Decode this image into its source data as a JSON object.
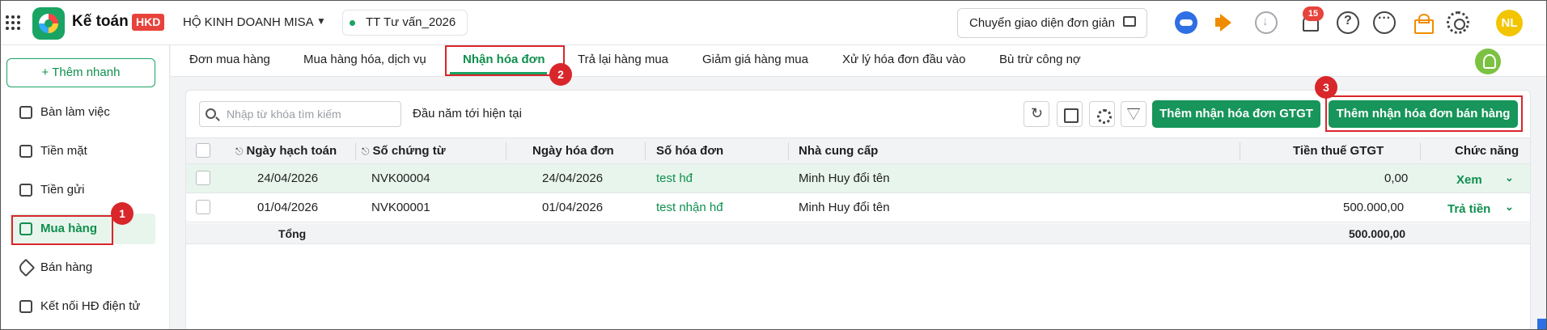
{
  "header": {
    "app_name": "Kế toán",
    "badge": "HKD",
    "company": "HỘ KINH DOANH MISA",
    "branch": "TT Tư vấn_2026",
    "switch_ui": "Chuyển giao diện đơn giản",
    "notifications": "15",
    "avatar": "NL",
    "icons": [
      "grid-icon",
      "misa-logo",
      "chevron-down-icon",
      "ai-assistant-icon",
      "megaphone-icon",
      "download-icon",
      "bell-icon",
      "help-icon",
      "more-icon",
      "gift-icon",
      "gear-icon"
    ]
  },
  "sidebar": {
    "quick_add": "+ Thêm nhanh",
    "items": [
      {
        "label": "Bàn làm việc",
        "icon": "dashboard-icon"
      },
      {
        "label": "Tiền mặt",
        "icon": "wallet-icon"
      },
      {
        "label": "Tiền gửi",
        "icon": "bank-icon"
      },
      {
        "label": "Mua hàng",
        "icon": "cart-icon",
        "active": true
      },
      {
        "label": "Bán hàng",
        "icon": "tag-icon"
      },
      {
        "label": "Kết nối HĐ điện tử",
        "icon": "e-invoice-icon"
      }
    ]
  },
  "tabs": [
    {
      "label": "Đơn mua hàng"
    },
    {
      "label": "Mua hàng hóa, dịch vụ"
    },
    {
      "label": "Nhận hóa đơn",
      "active": true
    },
    {
      "label": "Trả lại hàng mua"
    },
    {
      "label": "Giảm giá hàng mua"
    },
    {
      "label": "Xử lý hóa đơn đầu vào"
    },
    {
      "label": "Bù trừ công nợ"
    }
  ],
  "toolbar": {
    "search_placeholder": "Nhập từ khóa tìm kiếm",
    "period": "Đầu năm tới hiện tại",
    "add_vat": "Thêm nhận hóa đơn GTGT",
    "add_sales": "Thêm nhận hóa đơn bán hàng"
  },
  "table": {
    "columns": [
      "Ngày hạch toán",
      "Số chứng từ",
      "Ngày hóa đơn",
      "Số hóa đơn",
      "Nhà cung cấp",
      "Tiền thuế GTGT",
      "Chức năng"
    ],
    "rows": [
      {
        "posting_date": "24/04/2026",
        "voucher_no": "NVK00004",
        "invoice_date": "24/04/2026",
        "invoice_no": "test hđ",
        "supplier": "Minh Huy đổi tên",
        "vat": "0,00",
        "action": "Xem"
      },
      {
        "posting_date": "01/04/2026",
        "voucher_no": "NVK00001",
        "invoice_date": "01/04/2026",
        "invoice_no": "test nhận hđ",
        "supplier": "Minh Huy đổi tên",
        "vat": "500.000,00",
        "action": "Trả tiền"
      }
    ],
    "total_label": "Tổng",
    "total_vat": "500.000,00"
  },
  "annotations": {
    "step1": "1",
    "step2": "2",
    "step3": "3"
  },
  "colors": {
    "accent": "#17955a",
    "highlight": "#d9262a",
    "badge": "#e7423b"
  }
}
